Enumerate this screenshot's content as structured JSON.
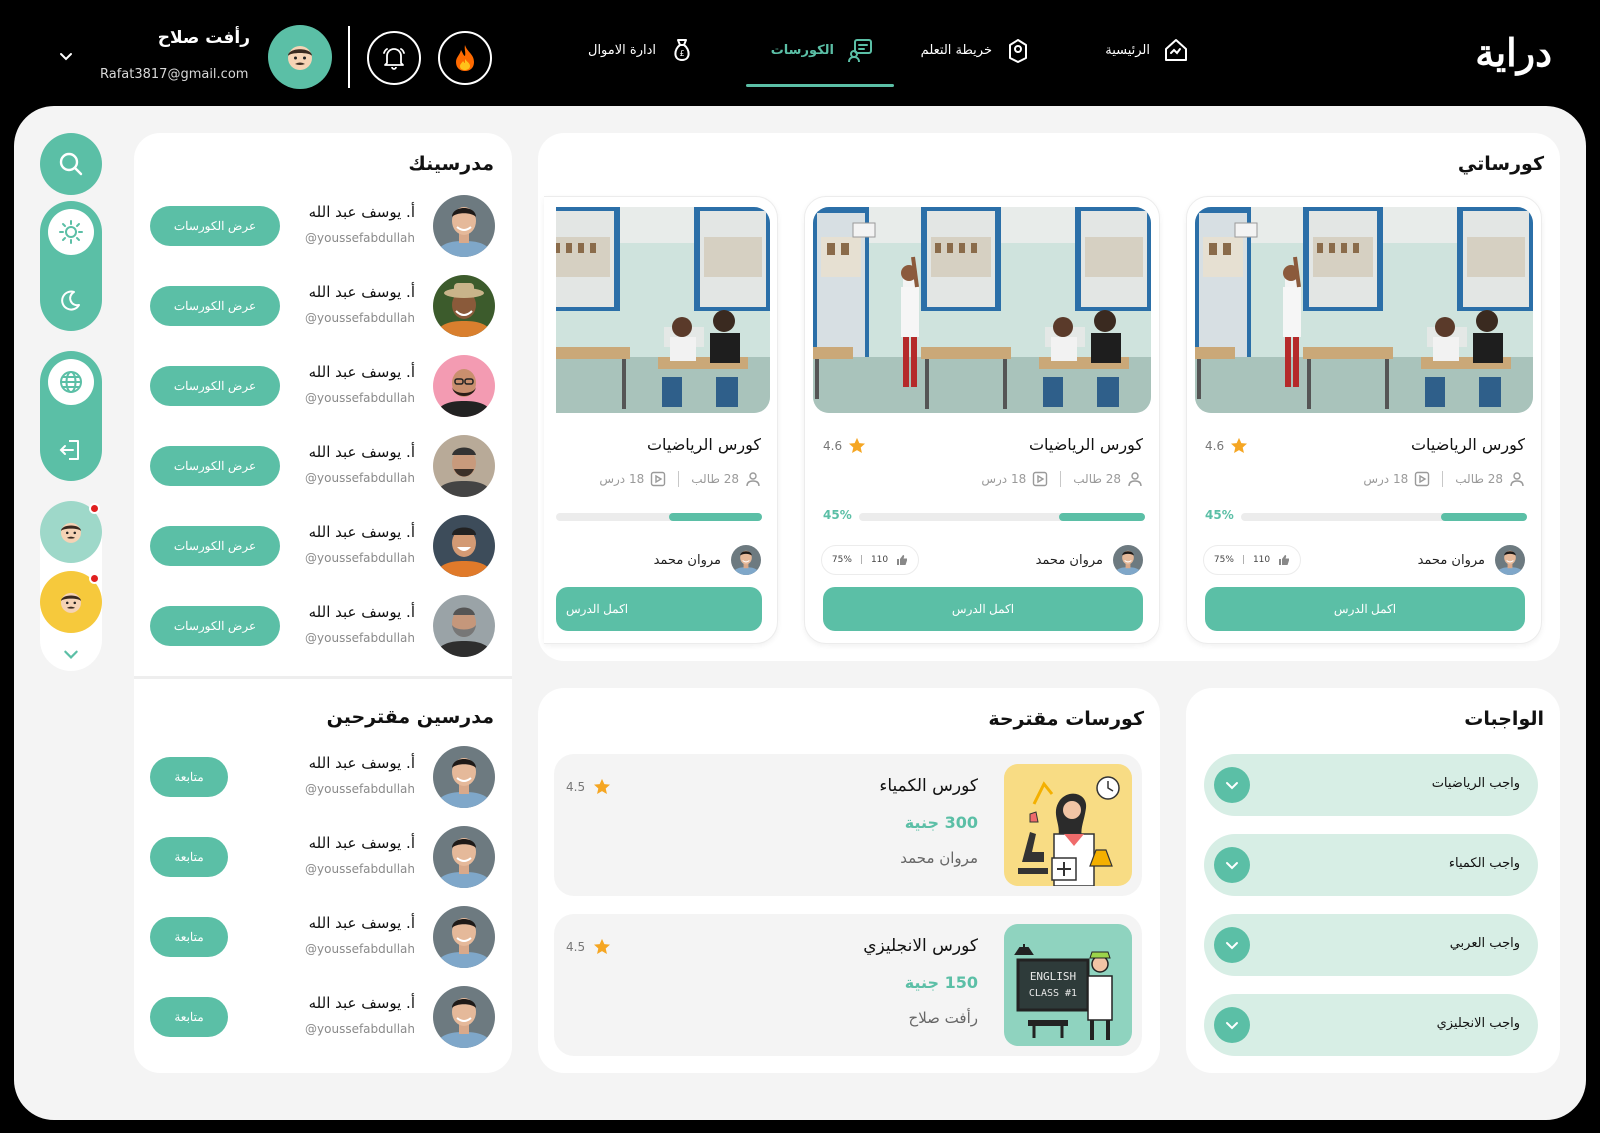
{
  "header": {
    "logo": "دراية",
    "nav": [
      {
        "label": "الرئيسية",
        "icon": "home-icon"
      },
      {
        "label": "خريطة التعلم",
        "icon": "map-pin-icon"
      },
      {
        "label": "الكورسات",
        "icon": "courses-icon",
        "active": true
      },
      {
        "label": "ادارة الاموال",
        "icon": "money-bag-icon"
      }
    ],
    "user": {
      "name": "رأفت صلاح",
      "email": "Rafat3817@gmail.com"
    }
  },
  "colors": {
    "accent": "#5bbfa6",
    "accent_light": "#d7eee5",
    "background": "#000000",
    "canvas": "#f4f4f4"
  },
  "my_courses": {
    "title": "كورساتي",
    "cards": [
      {
        "title": "كورس الرياضيات",
        "rating": "4.6",
        "students": "28 طالب",
        "lessons": "18 درس",
        "progress_label": "45%",
        "progress": 0.3,
        "teacher": "مروان محمد",
        "likes": "110",
        "percent": "75%",
        "button": "اكمل الدرس"
      },
      {
        "title": "كورس الرياضيات",
        "rating": "4.6",
        "students": "28 طالب",
        "lessons": "18 درس",
        "progress_label": "45%",
        "progress": 0.3,
        "teacher": "مروان محمد",
        "likes": "110",
        "percent": "75%",
        "button": "اكمل الدرس"
      },
      {
        "title": "كورس الرياضيات",
        "students": "28 طالب",
        "lessons": "18 درس",
        "progress": 0.45,
        "teacher": "مروان محمد",
        "button": "اكمل الدرس"
      }
    ]
  },
  "teachers": {
    "title": "مدرسينك",
    "button": "عرض الكورسات",
    "items": [
      {
        "name": "أ. يوسف عبد الله",
        "handle": "@youssefabdullah"
      },
      {
        "name": "أ. يوسف عبد الله",
        "handle": "@youssefabdullah"
      },
      {
        "name": "أ. يوسف عبد الله",
        "handle": "@youssefabdullah"
      },
      {
        "name": "أ. يوسف عبد الله",
        "handle": "@youssefabdullah"
      },
      {
        "name": "أ. يوسف عبد الله",
        "handle": "@youssefabdullah"
      },
      {
        "name": "أ. يوسف عبد الله",
        "handle": "@youssefabdullah"
      }
    ]
  },
  "suggested_teachers": {
    "title": "مدرسين مقترحين",
    "button": "متابعة",
    "items": [
      {
        "name": "أ. يوسف عبد الله",
        "handle": "@youssefabdullah"
      },
      {
        "name": "أ. يوسف عبد الله",
        "handle": "@youssefabdullah"
      },
      {
        "name": "أ. يوسف عبد الله",
        "handle": "@youssefabdullah"
      },
      {
        "name": "أ. يوسف عبد الله",
        "handle": "@youssefabdullah"
      }
    ]
  },
  "suggested_courses": {
    "title": "كورسات مقترحة",
    "items": [
      {
        "title": "كورس الكمياء",
        "price": "300 جنية",
        "teacher": "مروان محمد",
        "rating": "4.5"
      },
      {
        "title": "كورس الانجليزي",
        "price": "150 جنية",
        "teacher": "رأفت صلاح",
        "rating": "4.5"
      }
    ],
    "board_text": [
      "ENGLISH",
      "CLASS #1"
    ]
  },
  "homework": {
    "title": "الواجبات",
    "items": [
      {
        "label": "واجب الرياضيات"
      },
      {
        "label": "واجب الكمياء"
      },
      {
        "label": "واجب العربي"
      },
      {
        "label": "واجب الانجليزي"
      }
    ]
  }
}
